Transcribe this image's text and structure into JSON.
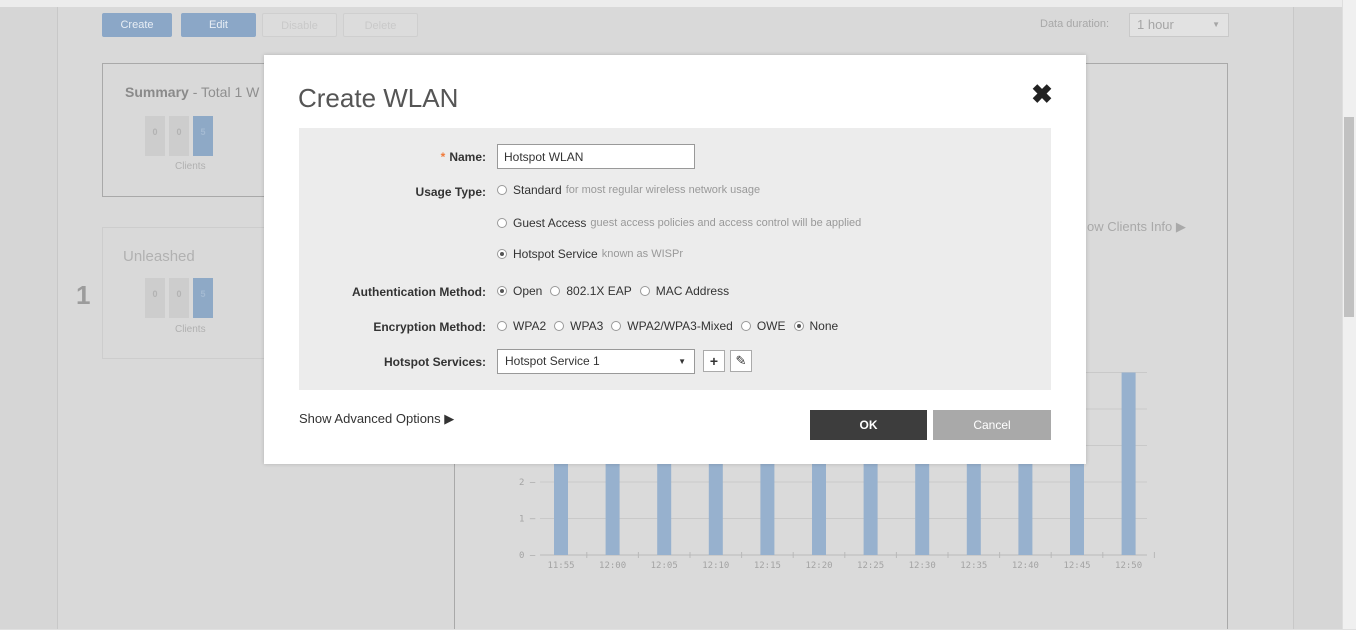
{
  "toolbar": {
    "create": "Create",
    "edit": "Edit",
    "disable": "Disable",
    "delete": "Delete",
    "data_duration_label": "Data duration:",
    "data_duration_value": "1 hour"
  },
  "summary": {
    "title_bold": "Summary",
    "title_rest": " - Total 1 W",
    "counts": [
      "0",
      "0",
      "5"
    ],
    "caption": "Clients"
  },
  "unleashed": {
    "title": "Unleashed",
    "index": "1",
    "counts": [
      "0",
      "0",
      "5"
    ],
    "caption": "Clients"
  },
  "show_clients_info": "ow Clients Info",
  "chart_data": {
    "type": "bar",
    "categories": [
      "11:55",
      "12:00",
      "12:05",
      "12:10",
      "12:15",
      "12:20",
      "12:25",
      "12:30",
      "12:35",
      "12:40",
      "12:45",
      "12:50"
    ],
    "y_ticks": [
      "0",
      "1",
      "2"
    ],
    "visible_bottom_value": 2.9,
    "values": [
      2.9,
      2.9,
      2.9,
      2.9,
      2.9,
      2.9,
      2.9,
      2.9,
      2.9,
      2.9,
      2.9,
      5.0
    ]
  },
  "modal": {
    "title": "Create WLAN",
    "close_glyph": "✖",
    "name_required": "*",
    "name_label": "Name:",
    "name_value": "Hotspot WLAN",
    "usage_label": "Usage Type:",
    "usage_options": [
      {
        "label": "Standard",
        "hint": "for most regular wireless network usage",
        "selected": false
      },
      {
        "label": "Guest Access",
        "hint": "guest access policies and access control will be applied",
        "selected": false
      },
      {
        "label": "Hotspot Service",
        "hint": "known as WISPr",
        "selected": true
      }
    ],
    "auth_label": "Authentication Method:",
    "auth_options": [
      {
        "label": "Open",
        "selected": true
      },
      {
        "label": "802.1X EAP",
        "selected": false
      },
      {
        "label": "MAC Address",
        "selected": false
      }
    ],
    "enc_label": "Encryption Method:",
    "enc_options": [
      {
        "label": "WPA2",
        "selected": false
      },
      {
        "label": "WPA3",
        "selected": false
      },
      {
        "label": "WPA2/WPA3-Mixed",
        "selected": false
      },
      {
        "label": "OWE",
        "selected": false
      },
      {
        "label": "None",
        "selected": true
      }
    ],
    "hotspot_label": "Hotspot Services:",
    "hotspot_value": "Hotspot Service 1",
    "add_glyph": "+",
    "edit_glyph": "✎",
    "advanced": "Show Advanced Options ▶",
    "ok": "OK",
    "cancel": "Cancel"
  }
}
